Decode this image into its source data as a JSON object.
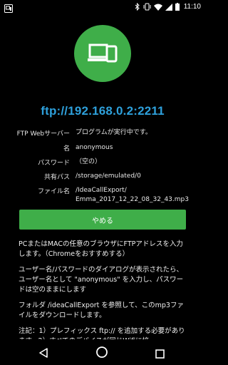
{
  "status_bar": {
    "time": "11:10",
    "icons": [
      "app-notification-icon",
      "bluetooth-icon",
      "vibrate-icon",
      "wifi-icon",
      "cellular-signal-icon",
      "battery-icon"
    ]
  },
  "hero": {
    "icon": "device-phone-laptop-icon"
  },
  "ftp": {
    "address": "ftp://192.168.0.2:2211"
  },
  "info": {
    "server_label": "FTP Webサーバー",
    "server_value": "プログラムが実行中です。",
    "name_label": "名",
    "name_value": "anonymous",
    "password_label": "パスワード",
    "password_value": "（空の）",
    "shared_path_label": "共有パス",
    "shared_path_value": "/storage/emulated/0",
    "filename_label": "ファイル名",
    "filename_value_line1": "/IdeaCallExport/",
    "filename_value_line2": "Emma_2017_12_22_08_32_43.mp3"
  },
  "stop_button": {
    "label": "やめる"
  },
  "instructions": {
    "p1": "PCまたはMACの任意のブラウザにFTPアドレスを入力します。（Chromeをおすすめする）",
    "p2": "ユーザー名/パスワードのダイアログが表示されたら、ユーザー名として \"anonymous\" を入力し、パスワードは空のままにします",
    "p3": "フォルダ /ideaCallExport を参照して、このmp3ファイルをダウンロードします。",
    "p4": "注記：1）プレフィックス ftp:// を追加する必要があります。2）すべてのデバイスが同じWifiに接"
  },
  "colors": {
    "accent_green": "#3fae49",
    "link_blue": "#2ea0db",
    "background": "#000000"
  },
  "nav_bar": {
    "icons": [
      "back-icon",
      "home-icon",
      "recent-apps-icon"
    ]
  }
}
